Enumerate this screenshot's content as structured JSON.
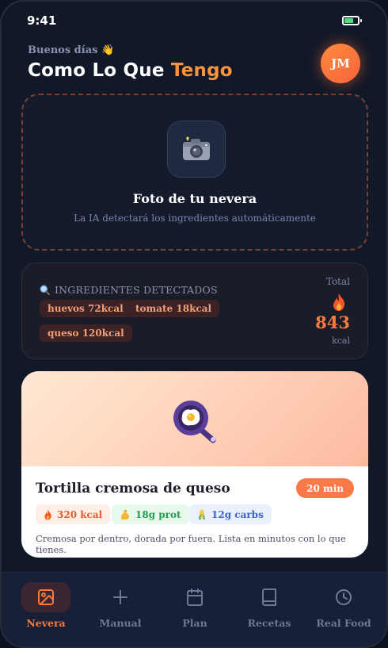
{
  "status_bar": {
    "time": "9:41",
    "battery_level_percent": 70
  },
  "header": {
    "greeting": "Buenos días 👋",
    "title_main": "Como Lo Que",
    "title_accent": "Tengo",
    "avatar_initials": "JM"
  },
  "upload": {
    "icon": "camera-icon",
    "title": "Foto de tu nevera",
    "subtitle": "La IA detectará los ingredientes automáticamente"
  },
  "ingredients": {
    "heading_icon": "magnifier-icon",
    "heading": "INGREDIENTES DETECTADOS",
    "items": [
      {
        "label": "huevos 72kcal"
      },
      {
        "label": "tomate 18kcal"
      },
      {
        "label": "queso 120kcal"
      }
    ],
    "total_label": "Total",
    "total_icon": "flame-icon",
    "total_value": "843",
    "total_unit": "kcal"
  },
  "recipe": {
    "image_icon": "frying-pan-egg-icon",
    "title": "Tortilla cremosa de queso",
    "time": "20 min",
    "stats": [
      {
        "icon": "flame-icon",
        "label": "320 kcal"
      },
      {
        "icon": "flexed-arm-icon",
        "label": "18g prot"
      },
      {
        "icon": "corn-icon",
        "label": "12g carbs"
      }
    ],
    "description": "Cremosa por dentro, dorada por fuera. Lista en minutos con lo que tienes."
  },
  "nav": {
    "active": "Nevera",
    "items": [
      {
        "label": "Nevera",
        "icon": "image-icon"
      },
      {
        "label": "Manual",
        "icon": "plus-icon"
      },
      {
        "label": "Plan",
        "icon": "calendar-icon"
      },
      {
        "label": "Recetas",
        "icon": "book-icon"
      },
      {
        "label": "Real Food",
        "icon": "clock-icon"
      }
    ]
  },
  "colors": {
    "accent": "#f97a3d",
    "background": "#111827",
    "card_dark": "#1a1c28",
    "navbar": "#172036"
  }
}
